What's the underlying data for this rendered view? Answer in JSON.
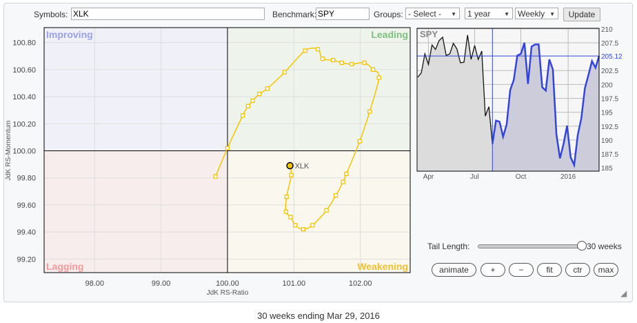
{
  "toolbar": {
    "symbols_label": "Symbols:",
    "symbols_value": "XLK",
    "benchmark_label": "Benchmark:",
    "benchmark_value": "SPY",
    "groups_label": "Groups:",
    "groups_value": "- Select -",
    "period_value": "1 year",
    "interval_value": "Weekly",
    "update_label": "Update"
  },
  "rrg": {
    "quadrants": {
      "improving": "Improving",
      "leading": "Leading",
      "lagging": "Lagging",
      "weakening": "Weakening"
    },
    "colors": {
      "improving_bg": "#eff0f8",
      "leading_bg": "#eef4ec",
      "lagging_bg": "#f8eded",
      "weakening_bg": "#f9f7ee",
      "improving": "#9aa0e8",
      "leading": "#7fbf7f",
      "lagging": "#f29a9a",
      "weakening": "#f0c030",
      "tail": "#f5c400"
    }
  },
  "chart_data": [
    {
      "type": "scatter",
      "xlabel": "JdK RS-Ratio",
      "ylabel": "JdK RS-Momentum",
      "xlim": [
        97.24,
        102.75
      ],
      "ylim": [
        99.1,
        100.91
      ],
      "xticks": [
        "98.00",
        "99.00",
        "100.00",
        "101.00",
        "102.00"
      ],
      "yticks": [
        "99.20",
        "99.40",
        "99.60",
        "99.80",
        "100.00",
        "100.20",
        "100.40",
        "100.60",
        "100.80"
      ],
      "series": [
        {
          "name": "XLK",
          "x": [
            99.82,
            100.0,
            100.23,
            100.31,
            100.38,
            100.48,
            100.6,
            100.86,
            101.17,
            101.36,
            101.43,
            101.59,
            101.72,
            101.87,
            102.06,
            102.19,
            102.28,
            102.14,
            101.99,
            101.79,
            101.74,
            101.63,
            101.49,
            101.28,
            101.14,
            101.02,
            100.95,
            100.88,
            100.89,
            100.96,
            100.94
          ],
          "y": [
            99.81,
            100.02,
            100.26,
            100.33,
            100.37,
            100.42,
            100.46,
            100.58,
            100.74,
            100.75,
            100.68,
            100.67,
            100.65,
            100.64,
            100.65,
            100.6,
            100.54,
            100.29,
            100.07,
            99.83,
            99.77,
            99.67,
            99.56,
            99.45,
            99.42,
            99.45,
            99.51,
            99.55,
            99.66,
            99.82,
            99.89
          ]
        }
      ]
    },
    {
      "type": "line",
      "title": "SPY",
      "ylim": [
        184.4,
        210.1
      ],
      "yticks": [
        "185",
        "187.5",
        "190",
        "192.5",
        "195",
        "197.5",
        "200",
        "202.5",
        "205.12",
        "207.5",
        "210"
      ],
      "xticks": [
        "Apr",
        "Jul",
        "Oct",
        "2016"
      ],
      "current_value": "205.12",
      "grid": true,
      "series": [
        {
          "values": [
            201.3,
            202.1,
            205.5,
            203.6,
            207.1,
            206.3,
            207.9,
            208.5,
            205.2,
            205.5,
            207.4,
            206.4,
            203.9,
            204.0,
            208.9,
            204.5,
            207.0,
            204.5,
            206.0,
            194.3,
            196.0,
            189.3
          ]
        },
        {
          "values": [
            189.3,
            193.5,
            193.3,
            190.6,
            192.8,
            199.0,
            200.8,
            205.2,
            205.5,
            207.5,
            200.1,
            206.8,
            207.2,
            207.2,
            199.5,
            198.9,
            204.5,
            202.7,
            191.0,
            186.7,
            189.3,
            192.6,
            186.9,
            185.5,
            190.9,
            193.9,
            199.3,
            201.7,
            204.2,
            203.0,
            205.1
          ]
        }
      ]
    }
  ],
  "controls": {
    "tail_label": "Tail Length:",
    "tail_value": "30 weeks",
    "tail_fraction": 1.0,
    "animate": "animate",
    "plus": "+",
    "minus": "−",
    "fit": "fit",
    "ctr": "ctr",
    "max": "max"
  },
  "caption": "30 weeks ending Mar 29, 2016"
}
